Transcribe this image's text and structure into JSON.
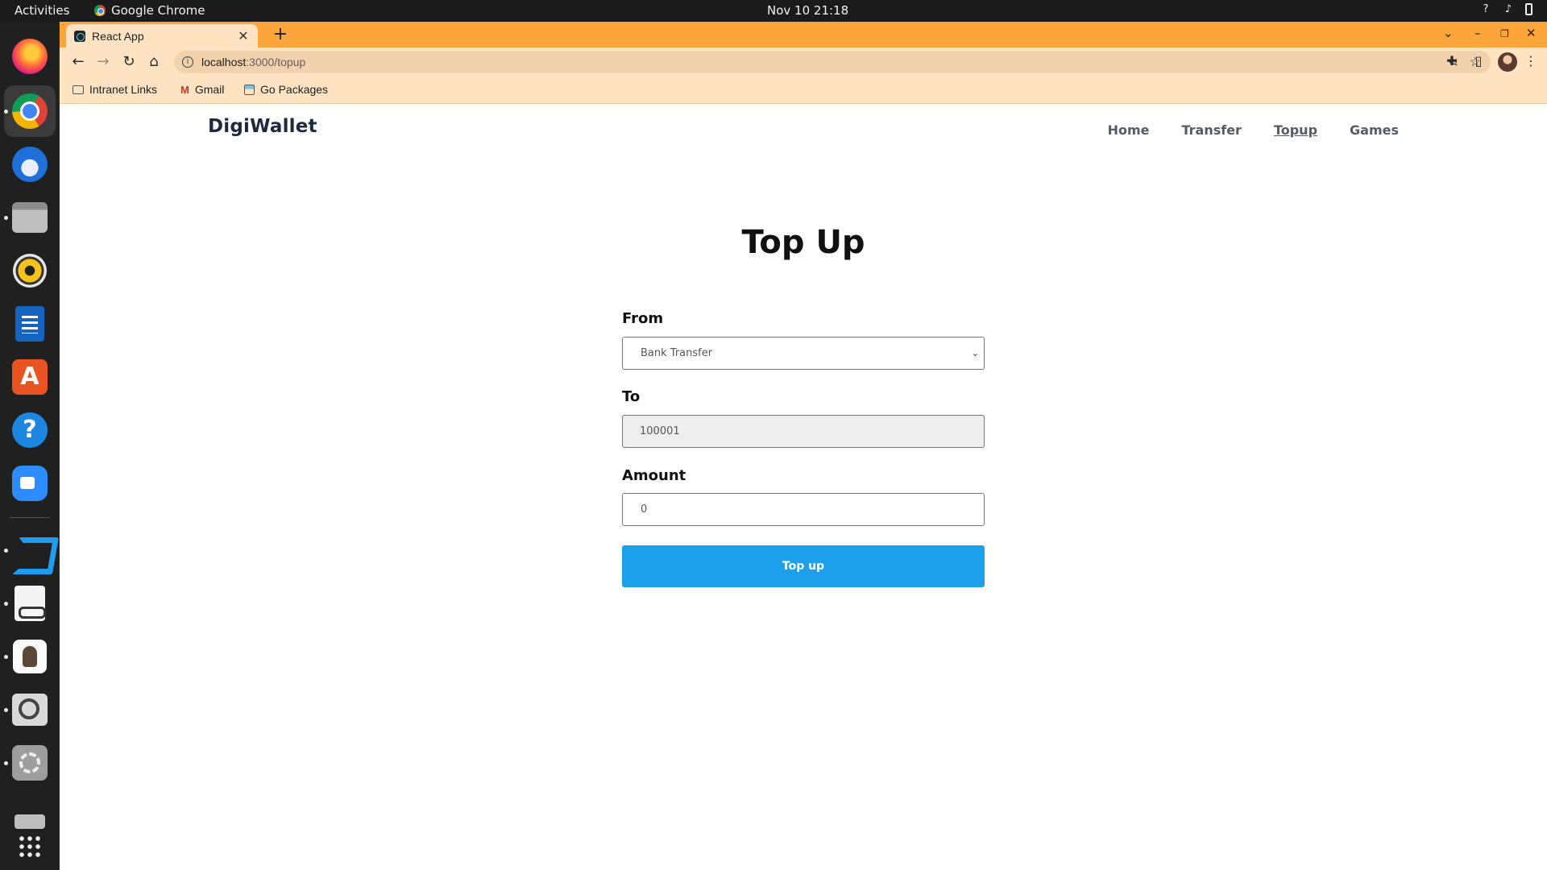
{
  "system": {
    "activities": "Activities",
    "app_name": "Google Chrome",
    "clock": "Nov 10  21:18"
  },
  "browser": {
    "tab_title": "React App",
    "url_host": "localhost",
    "url_path": ":3000/topup",
    "bookmarks": [
      {
        "label": "Intranet Links",
        "icon": "folder-icon"
      },
      {
        "label": "Gmail",
        "icon": "gmail-icon"
      },
      {
        "label": "Go Packages",
        "icon": "package-icon"
      }
    ]
  },
  "app": {
    "brand": "DigiWallet",
    "nav": [
      "Home",
      "Transfer",
      "Topup",
      "Games"
    ],
    "current_nav": "Topup"
  },
  "form": {
    "title": "Top Up",
    "from_label": "From",
    "from_value": "Bank Transfer",
    "to_label": "To",
    "to_value": "100001",
    "amount_label": "Amount",
    "amount_value": "0",
    "submit_label": "Top up"
  },
  "colors": {
    "tab_strip": "#fba53a",
    "toolbar": "#ffe3c2",
    "primary_button": "#1ca0ec",
    "brand_text": "#1e2a3b"
  }
}
